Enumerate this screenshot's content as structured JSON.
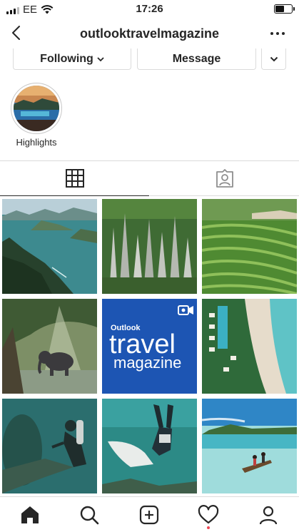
{
  "status_bar": {
    "carrier": "EE",
    "time": "17:26",
    "battery_level": 0.55
  },
  "header": {
    "username": "outlooktravelmagazine"
  },
  "actions": {
    "following_label": "Following",
    "message_label": "Message"
  },
  "highlights": [
    {
      "label": "Highlights"
    }
  ],
  "grid": {
    "posts": [
      {
        "id": "post-bay-islands"
      },
      {
        "id": "post-limestone-pinnacles"
      },
      {
        "id": "post-rice-terraces"
      },
      {
        "id": "post-elephant"
      },
      {
        "id": "post-magazine-logo"
      },
      {
        "id": "post-beach-resort"
      },
      {
        "id": "post-diver"
      },
      {
        "id": "post-manta-freediver"
      },
      {
        "id": "post-lagoon-boat"
      }
    ],
    "magazine": {
      "brand_small": "Outlook",
      "brand_large": "travel",
      "brand_sub": "magazine"
    }
  },
  "colors": {
    "text": "#262626",
    "border": "#dbdbdb",
    "notification": "#ed4956",
    "magazine_blue": "#1d55b3"
  },
  "icons": {
    "tabs": [
      "grid-icon",
      "tagged-icon"
    ],
    "tabbar": [
      "home-icon",
      "search-icon",
      "new-post-icon",
      "activity-heart-icon",
      "profile-icon"
    ]
  }
}
